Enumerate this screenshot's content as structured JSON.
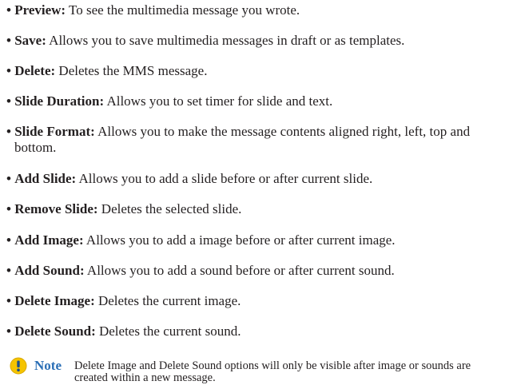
{
  "options": [
    {
      "term": "Preview:",
      "desc": " To see the multimedia message you wrote."
    },
    {
      "term": "Save:",
      "desc": " Allows you to save multimedia messages in draft or as templates."
    },
    {
      "term": "Delete:",
      "desc": " Deletes the MMS message."
    },
    {
      "term": "Slide Duration:",
      "desc": " Allows you to set timer for slide and text."
    },
    {
      "term": "Slide Format:",
      "desc": " Allows you to make the message contents aligned right, left, top and bottom."
    },
    {
      "term": "Add Slide:",
      "desc": " Allows you to add a slide before or after current slide."
    },
    {
      "term": "Remove Slide:",
      "desc": " Deletes the selected slide."
    },
    {
      "term": "Add Image:",
      "desc": " Allows you to add a image before or after current image."
    },
    {
      "term": "Add Sound:",
      "desc": " Allows you to add a sound before or after current sound."
    },
    {
      "term": "Delete Image:",
      "desc": " Deletes the current image."
    },
    {
      "term": "Delete Sound:",
      "desc": " Deletes the current sound."
    }
  ],
  "note": {
    "label": "Note",
    "text": "Delete Image and Delete Sound options will only be visible after image or sounds are created within a new message.",
    "icon": "exclamation-circle-icon",
    "icon_color": "#f5c400",
    "label_color": "#2b6fb6"
  }
}
